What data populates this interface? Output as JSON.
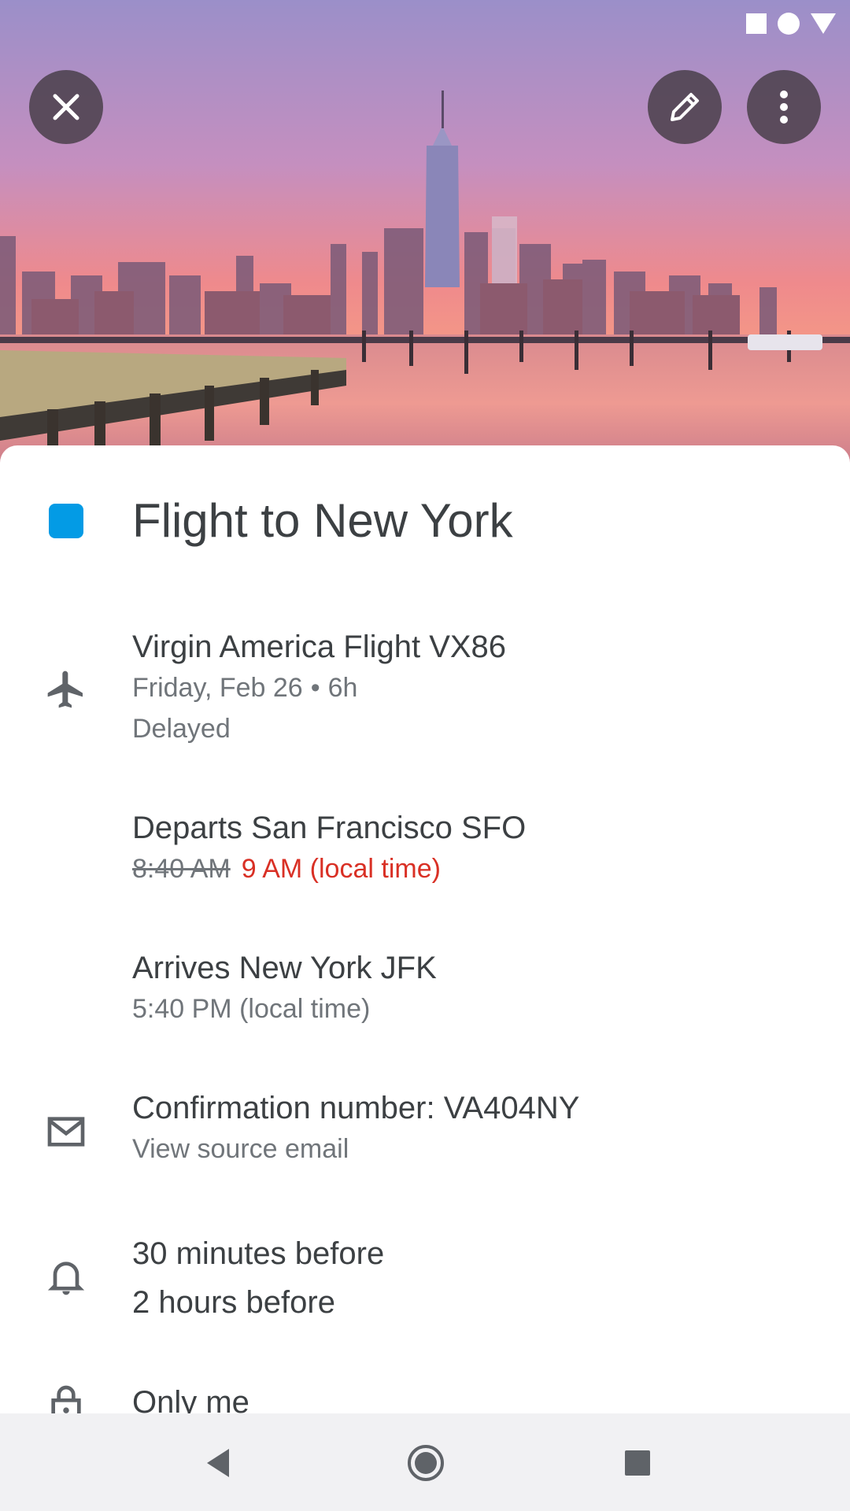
{
  "app": "Calendar",
  "status_bar": {
    "icons": [
      "square-icon",
      "circle-icon",
      "triangle-icon"
    ]
  },
  "header": {
    "close_icon": "close-icon",
    "edit_icon": "pencil-icon",
    "more_icon": "more-vert-icon",
    "image": "city-skyline-at-sunset"
  },
  "event": {
    "color": "#039be5",
    "title": "Flight to New York"
  },
  "flight": {
    "icon": "airplane-icon",
    "name": "Virgin America Flight VX86",
    "date": "Friday, Feb 26",
    "separator": "•",
    "duration": "6h",
    "status": "Delayed"
  },
  "departure": {
    "label": "Departs San Francisco SFO",
    "original_time": "8:40 AM",
    "new_time": "9 AM (local time)"
  },
  "arrival": {
    "label": "Arrives New York JFK",
    "time": "5:40 PM (local time)"
  },
  "confirmation": {
    "icon": "mail-icon",
    "label": "Confirmation number: VA404NY",
    "link": "View source email"
  },
  "notifications": {
    "icon": "bell-icon",
    "items": [
      "30 minutes before",
      "2 hours before"
    ]
  },
  "visibility": {
    "icon": "lock-icon",
    "label": "Only me"
  },
  "nav": {
    "back": "back-icon",
    "home": "home-icon",
    "recents": "recents-icon"
  },
  "colors": {
    "accent": "#039be5",
    "delayed": "#d93025",
    "primary_text": "#3c4043",
    "secondary_text": "#70757a"
  }
}
